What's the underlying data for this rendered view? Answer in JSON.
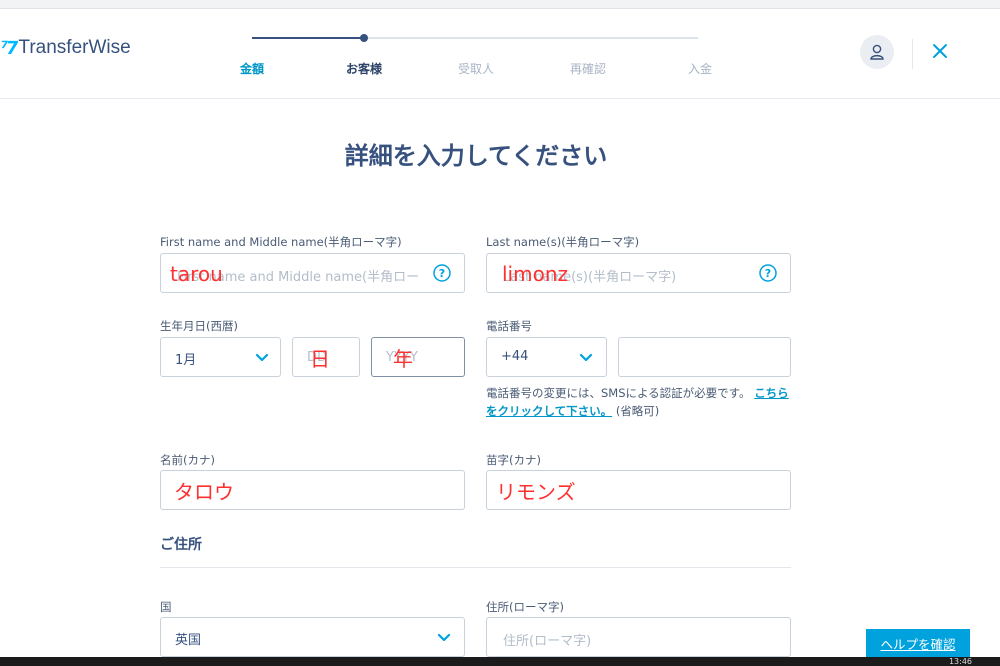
{
  "app": {
    "logo_mark": "⁷7",
    "logo_text": "TransferWise"
  },
  "steps": [
    {
      "label": "金額",
      "state": "done"
    },
    {
      "label": "お客様",
      "state": "current"
    },
    {
      "label": "受取人",
      "state": "todo"
    },
    {
      "label": "再確認",
      "state": "todo"
    },
    {
      "label": "入金",
      "state": "todo"
    }
  ],
  "page_title": "詳細を入力してください",
  "form": {
    "first_name": {
      "label": "First name and Middle name(半角ローマ字)",
      "placeholder": "First name and Middle name(半角ロー",
      "overlay": "tarou"
    },
    "last_name": {
      "label": "Last name(s)(半角ローマ字)",
      "placeholder": "Last name(s)(半角ローマ字)",
      "overlay": "limonz"
    },
    "dob": {
      "label": "生年月日(西暦)",
      "month_value": "1月",
      "day_placeholder": "DD",
      "day_overlay": "日",
      "year_placeholder": "YYYY",
      "year_overlay": "年"
    },
    "phone": {
      "label": "電話番号",
      "country_code": "+44",
      "value": "",
      "note_prefix": "電話番号の変更には、SMSによる認証が必要です。",
      "note_link": "こちらをクリックして下さい。",
      "note_suffix": "(省略可)"
    },
    "kana_first": {
      "label": "名前(カナ)",
      "overlay": "タロウ"
    },
    "kana_last": {
      "label": "苗字(カナ)",
      "overlay": "リモンズ"
    },
    "address_section_title": "ご住所",
    "country": {
      "label": "国",
      "value": "英国"
    },
    "address": {
      "label": "住所(ローマ字)",
      "placeholder": "住所(ローマ字)"
    }
  },
  "help_button": "ヘルプを確認",
  "taskbar_time": "13:46",
  "colors": {
    "accent": "#00b9ff",
    "link": "#0097c7",
    "navy": "#37517e",
    "overlay_red": "#ff3030",
    "help_button": "#00a2dd"
  }
}
